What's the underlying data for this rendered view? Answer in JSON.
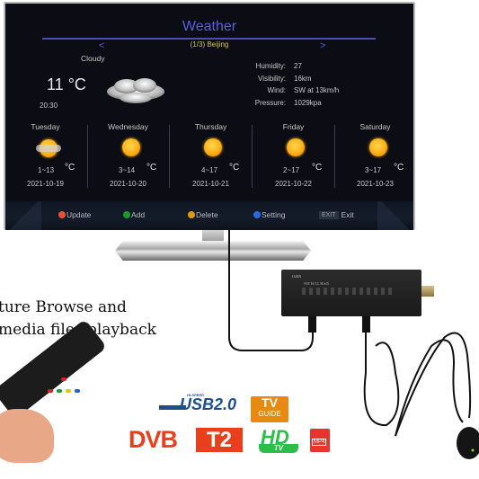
{
  "screen": {
    "title": "Weather",
    "city": "(1/3) Beijing",
    "nav_prev": "<",
    "nav_next": ">",
    "current": {
      "condition": "Cloudy",
      "temperature": "11",
      "unit": "°C",
      "time": "20:30",
      "icon": "cloud-icon"
    },
    "stats": [
      {
        "label": "Humidity:",
        "value": "27"
      },
      {
        "label": "Visibility:",
        "value": "16km"
      },
      {
        "label": "Wind:",
        "value": "SW at 13km/h"
      },
      {
        "label": "Pressure:",
        "value": "1029kpa"
      }
    ],
    "forecast": [
      {
        "day": "Tuesday",
        "range": "1~13",
        "unit": "°C",
        "date": "2021-10-19",
        "icon": "partly-cloudy-icon"
      },
      {
        "day": "Wednesday",
        "range": "3~14",
        "unit": "°C",
        "date": "2021-10-20",
        "icon": "sun-icon"
      },
      {
        "day": "Thursday",
        "range": "4~17",
        "unit": "°C",
        "date": "2021-10-21",
        "icon": "sun-icon"
      },
      {
        "day": "Friday",
        "range": "2~17",
        "unit": "°C",
        "date": "2021-10-22",
        "icon": "sun-icon"
      },
      {
        "day": "Saturday",
        "range": "3~17",
        "unit": "°C",
        "date": "2021-10-23",
        "icon": "sun-icon"
      }
    ],
    "footer": [
      {
        "label": "Update",
        "color": "#e8503a"
      },
      {
        "label": "Add",
        "color": "#1a9a2a"
      },
      {
        "label": "Delete",
        "color": "#e09a10"
      },
      {
        "label": "Setting",
        "color": "#2a6ae0"
      }
    ],
    "exit_key": "EXIT",
    "exit_label": "Exit"
  },
  "receiver": {
    "label_model": "MINI",
    "label_spec": "DVB T2 H.265"
  },
  "promo": {
    "line1": "ture Browse and",
    "line2": "  media files playback"
  },
  "logos": {
    "usb_hispeed": "HI-SPEED",
    "usb": "USB2.0",
    "tvguide_tv": "TV",
    "tvguide_guide": "GUIDE",
    "dvb": "DVB",
    "t2": "T2",
    "hd": "HD",
    "hdtv": "TV",
    "mp4": "MP4"
  },
  "colors": {
    "title": "#5a5ee0",
    "city": "#d6c64a",
    "screen_bg": "#0b0c14",
    "sun": "#ffae1a"
  }
}
